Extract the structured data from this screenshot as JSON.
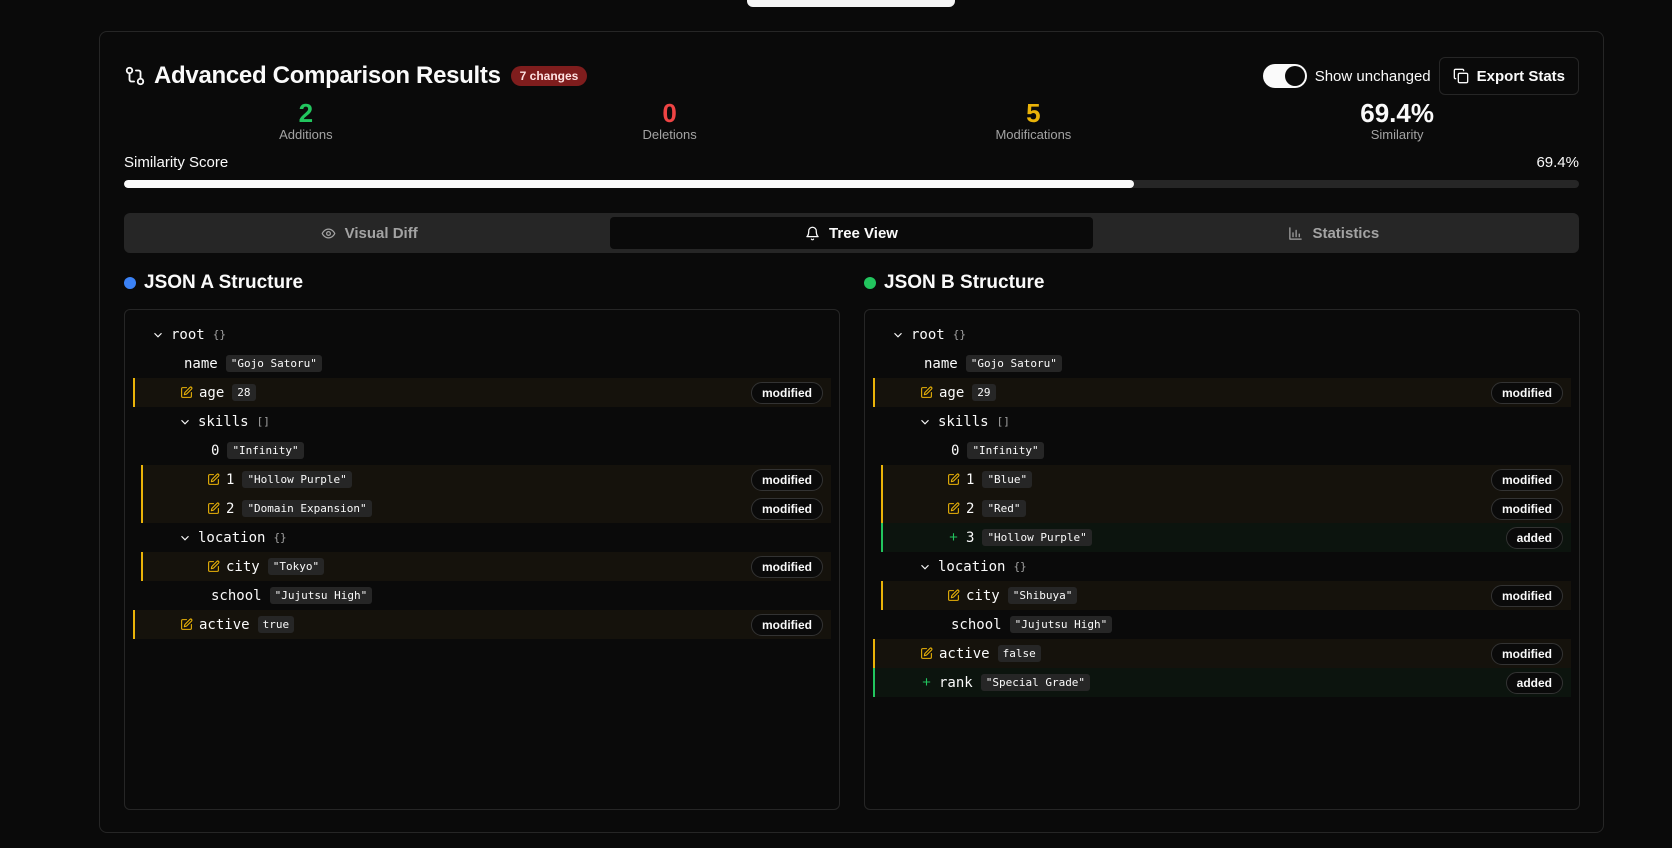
{
  "header": {
    "title": "Advanced Comparison Results",
    "badge": "7 changes",
    "toggle_label": "Show unchanged",
    "toggle_on": true,
    "export_label": "Export Stats"
  },
  "stats": [
    {
      "value": "2",
      "label": "Additions",
      "color": "#22c55e"
    },
    {
      "value": "0",
      "label": "Deletions",
      "color": "#ef4444"
    },
    {
      "value": "5",
      "label": "Modifications",
      "color": "#eab308"
    },
    {
      "value": "69.4%",
      "label": "Similarity",
      "color": "#fafafa"
    }
  ],
  "similarity": {
    "label": "Similarity Score",
    "value_text": "69.4%",
    "fraction": 0.694
  },
  "tabs": [
    {
      "label": "Visual Diff",
      "icon": "eye-icon",
      "active": false
    },
    {
      "label": "Tree View",
      "icon": "tree-icon",
      "active": true
    },
    {
      "label": "Statistics",
      "icon": "bar-chart-icon",
      "active": false
    }
  ],
  "treeA": {
    "title": "JSON A Structure",
    "dot_color": "#3b82f6",
    "nodes": [
      {
        "depth": 0,
        "key": "root",
        "type": "{}",
        "expand": true
      },
      {
        "depth": 1,
        "key": "name",
        "value": "\"Gojo Satoru\""
      },
      {
        "depth": 1,
        "key": "age",
        "value": "28",
        "status": "modified"
      },
      {
        "depth": 1,
        "key": "skills",
        "type": "[]",
        "expand": true
      },
      {
        "depth": 2,
        "key": "0",
        "value": "\"Infinity\""
      },
      {
        "depth": 2,
        "key": "1",
        "value": "\"Hollow Purple\"",
        "status": "modified"
      },
      {
        "depth": 2,
        "key": "2",
        "value": "\"Domain Expansion\"",
        "status": "modified"
      },
      {
        "depth": 1,
        "key": "location",
        "type": "{}",
        "expand": true
      },
      {
        "depth": 2,
        "key": "city",
        "value": "\"Tokyo\"",
        "status": "modified"
      },
      {
        "depth": 2,
        "key": "school",
        "value": "\"Jujutsu High\""
      },
      {
        "depth": 1,
        "key": "active",
        "value": "true",
        "status": "modified"
      }
    ]
  },
  "treeB": {
    "title": "JSON B Structure",
    "dot_color": "#22c55e",
    "nodes": [
      {
        "depth": 0,
        "key": "root",
        "type": "{}",
        "expand": true
      },
      {
        "depth": 1,
        "key": "name",
        "value": "\"Gojo Satoru\""
      },
      {
        "depth": 1,
        "key": "age",
        "value": "29",
        "status": "modified"
      },
      {
        "depth": 1,
        "key": "skills",
        "type": "[]",
        "expand": true
      },
      {
        "depth": 2,
        "key": "0",
        "value": "\"Infinity\""
      },
      {
        "depth": 2,
        "key": "1",
        "value": "\"Blue\"",
        "status": "modified"
      },
      {
        "depth": 2,
        "key": "2",
        "value": "\"Red\"",
        "status": "modified"
      },
      {
        "depth": 2,
        "key": "3",
        "value": "\"Hollow Purple\"",
        "status": "added"
      },
      {
        "depth": 1,
        "key": "location",
        "type": "{}",
        "expand": true
      },
      {
        "depth": 2,
        "key": "city",
        "value": "\"Shibuya\"",
        "status": "modified"
      },
      {
        "depth": 2,
        "key": "school",
        "value": "\"Jujutsu High\""
      },
      {
        "depth": 1,
        "key": "active",
        "value": "false",
        "status": "modified"
      },
      {
        "depth": 1,
        "key": "rank",
        "value": "\"Special Grade\"",
        "status": "added"
      }
    ]
  }
}
